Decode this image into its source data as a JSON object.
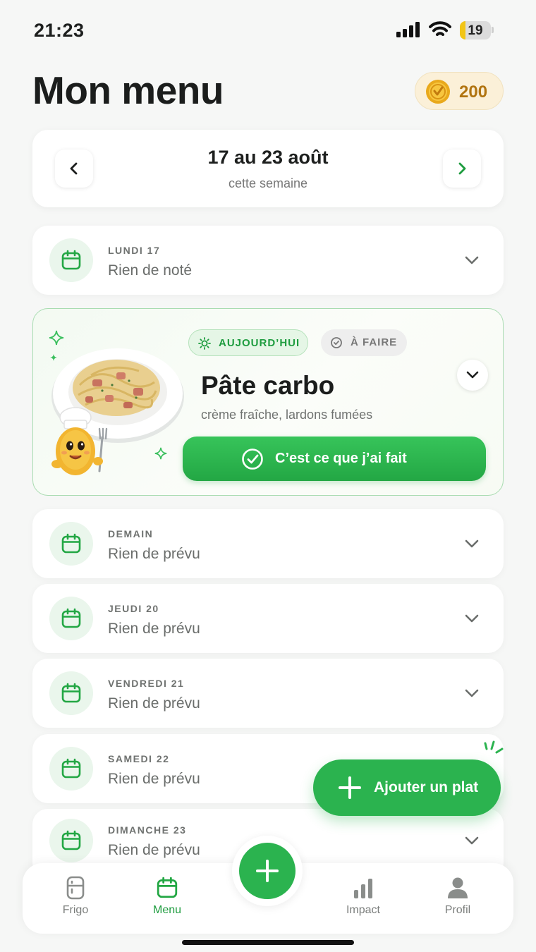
{
  "status_bar": {
    "time": "21:23",
    "battery_level": "19",
    "battery_fraction": 0.19
  },
  "header": {
    "title": "Mon menu",
    "coins": "200",
    "coin_icon": "coin-icon"
  },
  "week": {
    "range": "17 au 23 août",
    "subtitle": "cette semaine",
    "prev_icon": "chevron-left-icon",
    "next_icon": "chevron-right-icon"
  },
  "days_before": [
    {
      "name": "LUNDI 17",
      "state": "Rien de noté"
    }
  ],
  "today": {
    "badge_today": "AUJOURD’HUI",
    "badge_todo": "À FAIRE",
    "dish": "Pâte carbo",
    "description": "crème fraîche, lardons fumées",
    "done_label": "C’est ce que j’ai fait"
  },
  "days_after": [
    {
      "name": "DEMAIN",
      "state": "Rien de prévu"
    },
    {
      "name": "JEUDI 20",
      "state": "Rien de prévu"
    },
    {
      "name": "VENDREDI 21",
      "state": "Rien de prévu"
    },
    {
      "name": "SAMEDI 22",
      "state": "Rien de prévu"
    },
    {
      "name": "DIMANCHE 23",
      "state": "Rien de prévu"
    }
  ],
  "fab": {
    "label": "Ajouter un plat"
  },
  "tabs": [
    {
      "label": "Frigo",
      "icon": "fridge-icon",
      "active": false
    },
    {
      "label": "Menu",
      "icon": "calendar-icon",
      "active": true
    },
    {
      "label": "Impact",
      "icon": "bar-chart-icon",
      "active": false
    },
    {
      "label": "Profil",
      "icon": "user-icon",
      "active": false
    }
  ],
  "colors": {
    "accent": "#2bb34f",
    "accent_dark": "#1e9c3f",
    "coin": "#b17410",
    "background": "#f6f7f6"
  }
}
